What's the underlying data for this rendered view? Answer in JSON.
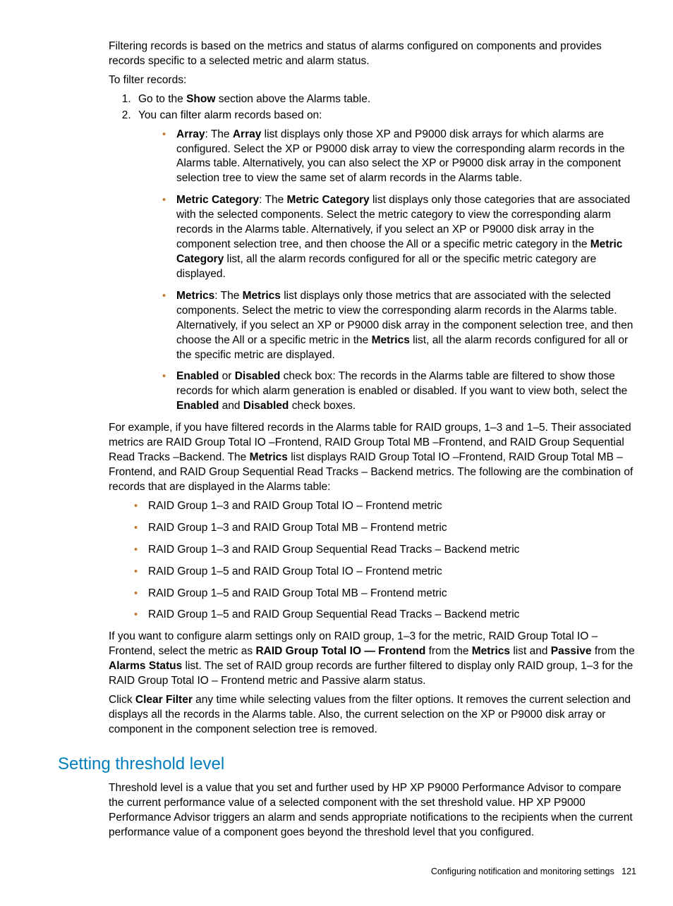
{
  "intro_para": "Filtering records is based on the metrics and status of alarms configured on components and provides records specific to a selected metric and alarm status.",
  "to_filter": "To filter records:",
  "step1_pre": "Go to the ",
  "step1_bold": "Show",
  "step1_post": " section above the Alarms table.",
  "step2": "You can filter alarm records based on:",
  "bullet_array": {
    "b1": "Array",
    "t1": ": The ",
    "b2": "Array",
    "t2": " list displays only those XP and P9000 disk arrays for which alarms are configured. Select the XP or P9000 disk array to view the corresponding alarm records in the Alarms table. Alternatively, you can also select the XP or P9000 disk array in the component selection tree to view the same set of alarm records in the Alarms table."
  },
  "bullet_mc": {
    "b1": "Metric Category",
    "t1": ": The ",
    "b2": "Metric Category",
    "t2": " list displays only those categories that are associated with the selected components. Select the metric category to view the corresponding alarm records in the Alarms table. Alternatively, if you select an XP or P9000 disk array in the component selection tree, and then choose the All or a specific metric category in the ",
    "b3": "Metric Category",
    "t3": " list, all the alarm records configured for all or the specific metric category are displayed."
  },
  "bullet_metrics": {
    "b1": "Metrics",
    "t1": ": The ",
    "b2": "Metrics",
    "t2": " list displays only those metrics that are associated with the selected components. Select the metric to view the corresponding alarm records in the Alarms table. Alternatively, if you select an XP or P9000 disk array in the component selection tree, and then choose the All or a specific metric in the ",
    "b3": "Metrics",
    "t3": " list, all the alarm records configured for all or the specific metric are displayed."
  },
  "bullet_enabled": {
    "b1": "Enabled",
    "t1": " or ",
    "b2": "Disabled",
    "t2": " check box: The records in the Alarms table are filtered to show those records for which alarm generation is enabled or disabled. If you want to view both, select the ",
    "b3": "Enabled",
    "t3": " and ",
    "b4": "Disabled",
    "t4": " check boxes."
  },
  "example_para": {
    "t1": "For example, if you have filtered records in the Alarms table for RAID groups, 1–3 and 1–5. Their associated metrics are RAID Group Total IO –Frontend, RAID Group Total MB –Frontend, and RAID Group Sequential Read Tracks –Backend. The ",
    "b1": "Metrics",
    "t2": " list displays RAID Group Total IO –Frontend, RAID Group Total MB – Frontend, and RAID Group Sequential Read Tracks – Backend metrics. The following are the combination of records that are displayed in the Alarms table:"
  },
  "combo": [
    "RAID Group 1–3 and RAID Group Total IO – Frontend metric",
    "RAID Group 1–3 and RAID Group Total MB – Frontend metric",
    "RAID Group 1–3 and RAID Group Sequential Read Tracks – Backend metric",
    "RAID Group 1–5 and RAID Group Total IO – Frontend metric",
    "RAID Group 1–5 and RAID Group Total MB – Frontend metric",
    "RAID Group 1–5 and RAID Group Sequential Read Tracks – Backend metric"
  ],
  "config_para": {
    "t1": "If you want to configure alarm settings only on RAID group, 1–3 for the metric, RAID Group Total IO –Frontend, select the metric as ",
    "b1": "RAID Group Total IO — Frontend",
    "t2": " from the ",
    "b2": "Metrics",
    "t3": " list and ",
    "b3": "Passive",
    "t4": " from the ",
    "b4": "Alarms Status",
    "t5": " list. The set of RAID group records are further filtered to display only RAID group, 1–3 for the RAID Group Total IO – Frontend metric and Passive alarm status."
  },
  "clear_para": {
    "t1": "Click ",
    "b1": "Clear Filter",
    "t2": " any time while selecting values from the filter options. It removes the current selection and displays all the records in the Alarms table. Also, the current selection on the XP or P9000 disk array or component in the component selection tree is removed."
  },
  "section_heading": "Setting threshold level",
  "threshold_para": "Threshold level is a value that you set and further used by HP XP P9000 Performance Advisor to compare the current performance value of a selected component with the set threshold value. HP XP P9000 Performance Advisor triggers an alarm and sends appropriate notifications to the recipients when the current performance value of a component goes beyond the threshold level that you configured.",
  "footer_text": "Configuring notification and monitoring settings",
  "footer_page": "121"
}
